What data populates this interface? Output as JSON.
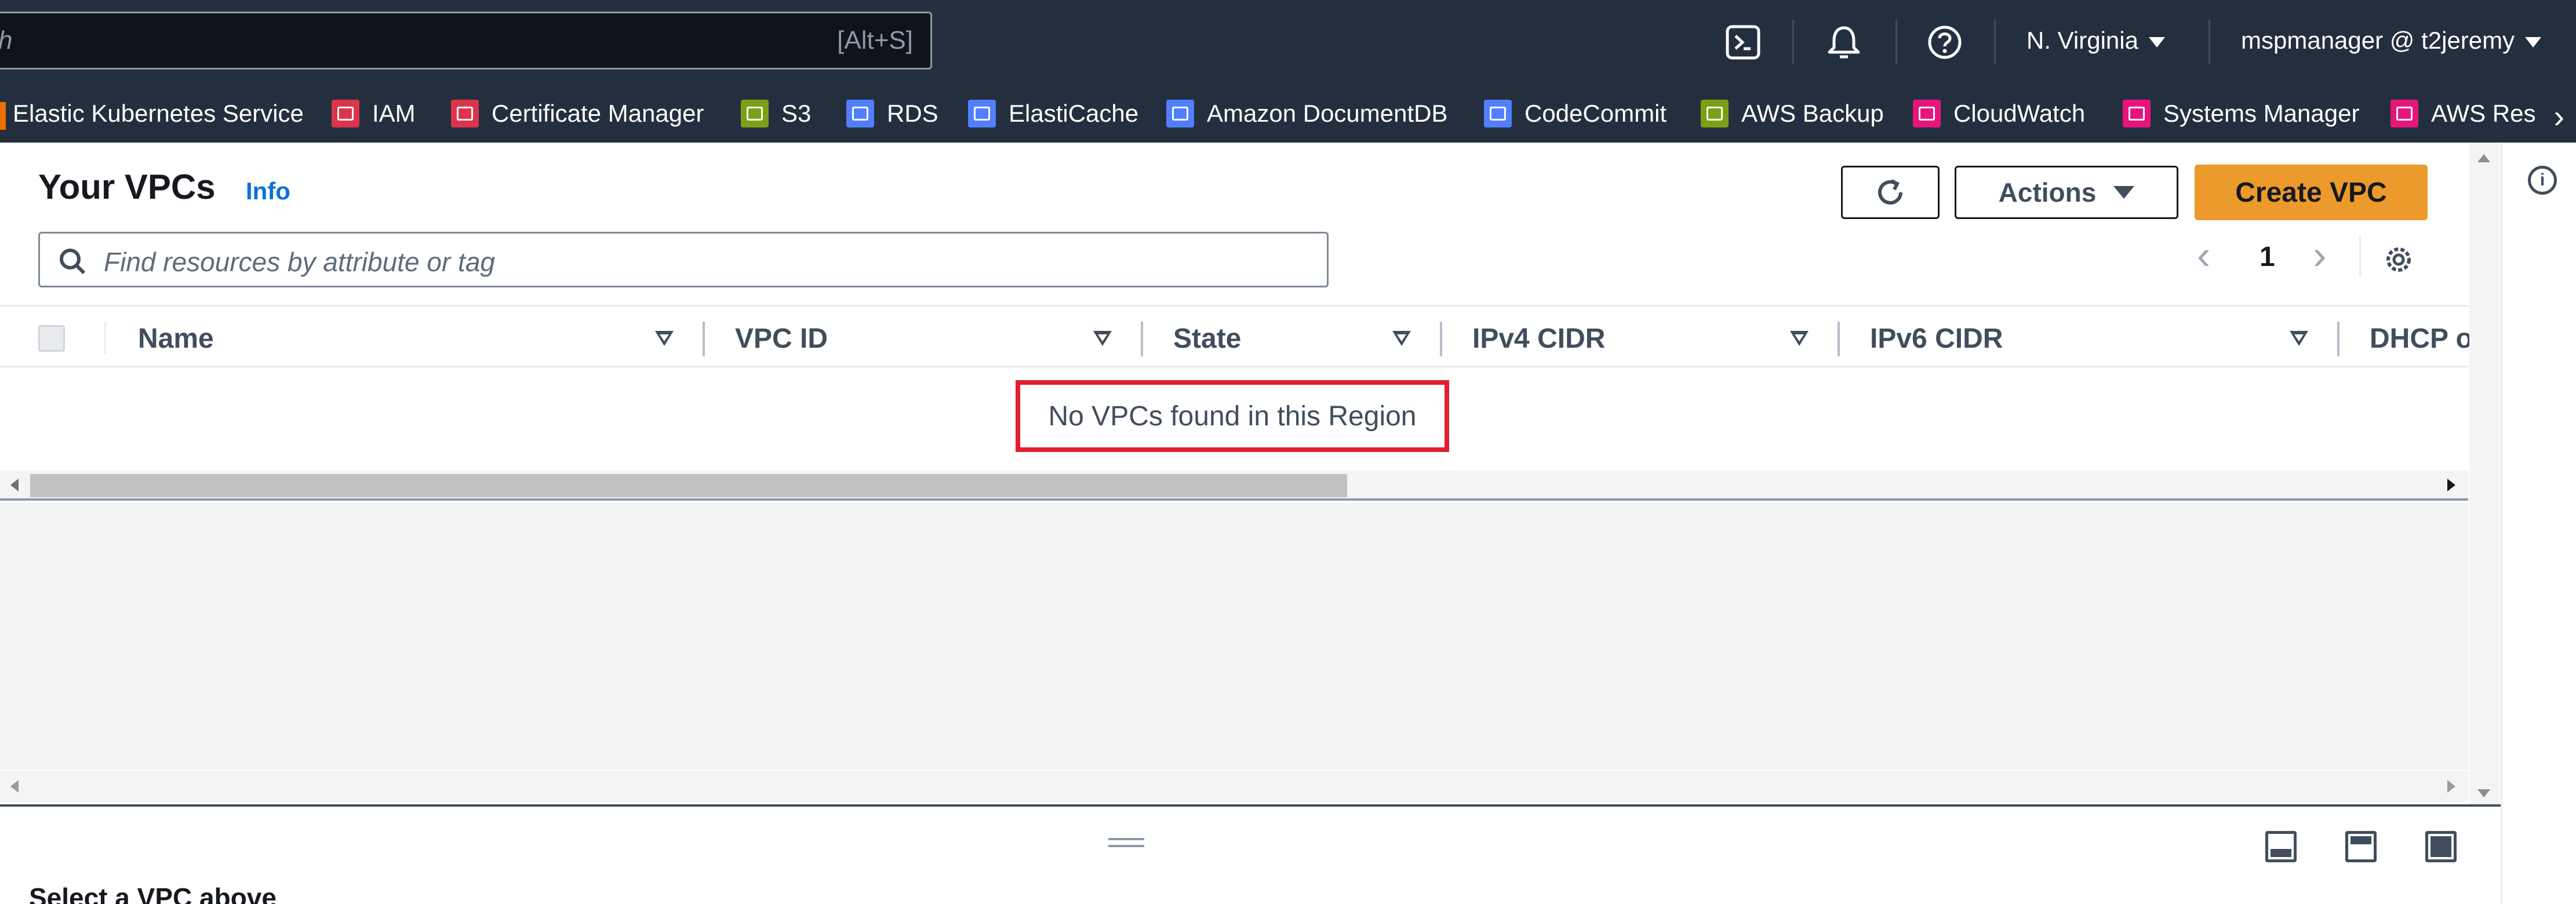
{
  "topnav": {
    "search_placeholder": "h",
    "search_shortcut": "[Alt+S]",
    "region": "N. Virginia",
    "account": "mspmanager @ t2jeremy"
  },
  "favorites": [
    {
      "label": "Elastic Kubernetes Service",
      "color": "#ed7100"
    },
    {
      "label": "IAM",
      "color": "#dd344c"
    },
    {
      "label": "Certificate Manager",
      "color": "#dd344c"
    },
    {
      "label": "S3",
      "color": "#7aa116"
    },
    {
      "label": "RDS",
      "color": "#527fff"
    },
    {
      "label": "ElastiCache",
      "color": "#527fff"
    },
    {
      "label": "Amazon DocumentDB",
      "color": "#527fff"
    },
    {
      "label": "CodeCommit",
      "color": "#527fff"
    },
    {
      "label": "AWS Backup",
      "color": "#7aa116"
    },
    {
      "label": "CloudWatch",
      "color": "#e7157b"
    },
    {
      "label": "Systems Manager",
      "color": "#e7157b"
    },
    {
      "label": "AWS Res",
      "color": "#e7157b"
    }
  ],
  "page": {
    "title": "Your VPCs",
    "info": "Info",
    "actions_label": "Actions",
    "create_label": "Create VPC",
    "filter_placeholder": "Find resources by attribute or tag",
    "current_page": "1"
  },
  "table": {
    "columns": [
      "Name",
      "VPC ID",
      "State",
      "IPv4 CIDR",
      "IPv6 CIDR",
      "DHCP o"
    ],
    "empty_message": "No VPCs found in this Region"
  },
  "split_panel": {
    "title": "Select a VPC above"
  },
  "colors": {
    "nav_bg": "#232f3e",
    "primary_button": "#ec9a2b",
    "link": "#0972d3",
    "highlight_border": "#e0202e"
  }
}
